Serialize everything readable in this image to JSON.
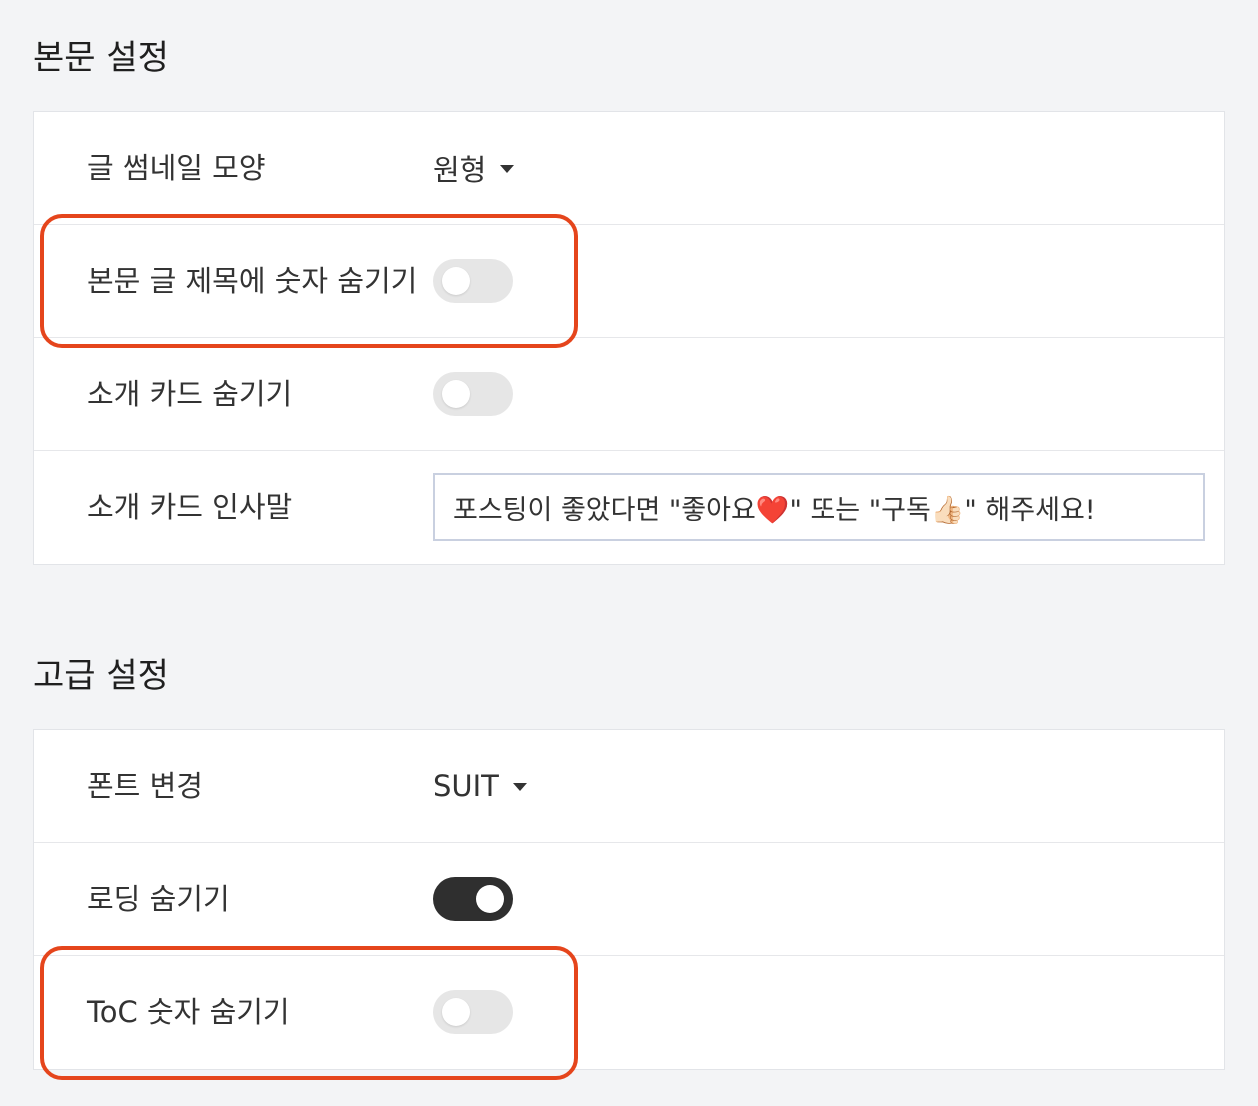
{
  "body_settings": {
    "title": "본문 설정",
    "thumbnail_shape": {
      "label": "글 썸네일 모양",
      "value": "원형"
    },
    "hide_title_numbers": {
      "label": "본문 글 제목에 숫자 숨기기",
      "enabled": false
    },
    "hide_intro_card": {
      "label": "소개 카드 숨기기",
      "enabled": false
    },
    "intro_greeting": {
      "label": "소개 카드 인사말",
      "value": "포스팅이 좋았다면 \"좋아요❤️\" 또는 \"구독👍🏻\" 해주세요!"
    }
  },
  "advanced_settings": {
    "title": "고급 설정",
    "font": {
      "label": "폰트 변경",
      "value": "SUIT"
    },
    "hide_loading": {
      "label": "로딩 숨기기",
      "enabled": true
    },
    "hide_toc_numbers": {
      "label": "ToC 숫자 숨기기",
      "enabled": false
    }
  },
  "colors": {
    "highlight": "#e5451c",
    "toggle_on": "#2f2f2f",
    "toggle_off": "#e6e6e6",
    "page_background": "#f3f4f6"
  },
  "icons": {
    "dropdown": "caret-down-icon"
  }
}
